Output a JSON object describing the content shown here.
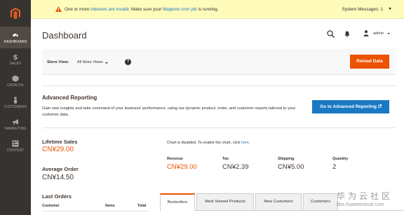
{
  "sidebar": {
    "items": [
      {
        "label": "DASHBOARD",
        "icon": "dashboard-icon",
        "active": true
      },
      {
        "label": "SALES",
        "icon": "dollar-icon"
      },
      {
        "label": "CATALOG",
        "icon": "catalog-box-icon"
      },
      {
        "label": "CUSTOMERS",
        "icon": "customer-person-icon"
      },
      {
        "label": "MARKETING",
        "icon": "megaphone-icon"
      },
      {
        "label": "CONTENT",
        "icon": "content-layout-icon"
      }
    ]
  },
  "notice": {
    "prefix": "One or more ",
    "link1": "indexers are invalid",
    "middle": ". Make sure your ",
    "link2": "Magento cron job",
    "suffix": " is running.",
    "system_messages": "System Messages: 1"
  },
  "header": {
    "title": "Dashboard",
    "username": "admin"
  },
  "store_view": {
    "label": "Store View:",
    "selected": "All Store Views",
    "reload_button": "Reload Data"
  },
  "advanced_reporting": {
    "title": "Advanced Reporting",
    "description": "Gain new insights and take command of your business' performance, using our dynamic product, order, and customer reports tailored to your customer data.",
    "button": "Go to Advanced Reporting"
  },
  "lifetime_sales": {
    "label": "Lifetime Sales",
    "value": "CN¥29.00"
  },
  "average_order": {
    "label": "Average Order",
    "value": "CN¥14.50"
  },
  "last_orders": {
    "title": "Last Orders",
    "columns": [
      "Customer",
      "Items",
      "Total"
    ]
  },
  "chart_notice": {
    "text": "Chart is disabled. To enable the chart, click ",
    "link": "here",
    "suffix": "."
  },
  "totals": [
    {
      "label": "Revenue",
      "value": "CN¥29.00"
    },
    {
      "label": "Tax",
      "value": "CN¥2.39"
    },
    {
      "label": "Shipping",
      "value": "CN¥5.00"
    },
    {
      "label": "Quantity",
      "value": "2"
    }
  ],
  "tabs": [
    "Bestsellers",
    "Most Viewed Products",
    "New Customers",
    "Customers"
  ],
  "watermark": {
    "text": "华为云社区",
    "url": "bbs.huaweicloud.com"
  },
  "colors": {
    "accent": "#eb5202",
    "link": "#1979c3",
    "sidebar": "#373330",
    "notice_bg": "#fffbbb"
  }
}
